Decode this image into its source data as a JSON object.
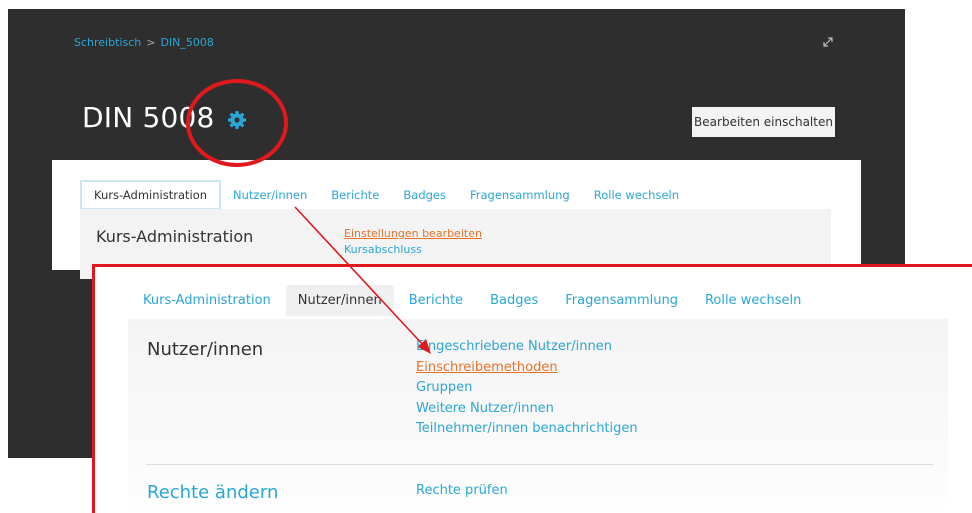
{
  "breadcrumb": {
    "home": "Schreibtisch",
    "separator": ">",
    "course": "DIN_5008"
  },
  "header": {
    "title": "DIN 5008",
    "edit_button": "Bearbeiten einschalten"
  },
  "icons": {
    "settings": "gear-icon",
    "fullscreen": "expand-icon"
  },
  "panel1": {
    "tabs": [
      {
        "label": "Kurs-Administration"
      },
      {
        "label": "Nutzer/innen"
      },
      {
        "label": "Berichte"
      },
      {
        "label": "Badges"
      },
      {
        "label": "Fragensammlung"
      },
      {
        "label": "Rolle wechseln"
      }
    ],
    "section_title": "Kurs-Administration",
    "links": [
      {
        "label": "Einstellungen bearbeiten"
      },
      {
        "label": "Kursabschluss"
      }
    ]
  },
  "panel2": {
    "tabs": [
      {
        "label": "Kurs-Administration"
      },
      {
        "label": "Nutzer/innen"
      },
      {
        "label": "Berichte"
      },
      {
        "label": "Badges"
      },
      {
        "label": "Fragensammlung"
      },
      {
        "label": "Rolle wechseln"
      }
    ],
    "section_title": "Nutzer/innen",
    "links": [
      {
        "label": "Eingeschriebene Nutzer/innen"
      },
      {
        "label": "Einschreibemethoden"
      },
      {
        "label": "Gruppen"
      },
      {
        "label": "Weitere Nutzer/innen"
      },
      {
        "label": "Teilnehmer/innen benachrichtigen"
      }
    ],
    "rights_title": "Rechte ändern",
    "rights_link": "Rechte prüfen"
  },
  "colors": {
    "accent": "#2aa6d6",
    "highlight": "#e8722b",
    "annotation": "#e0191e",
    "header_bg": "#2e2e2e"
  }
}
